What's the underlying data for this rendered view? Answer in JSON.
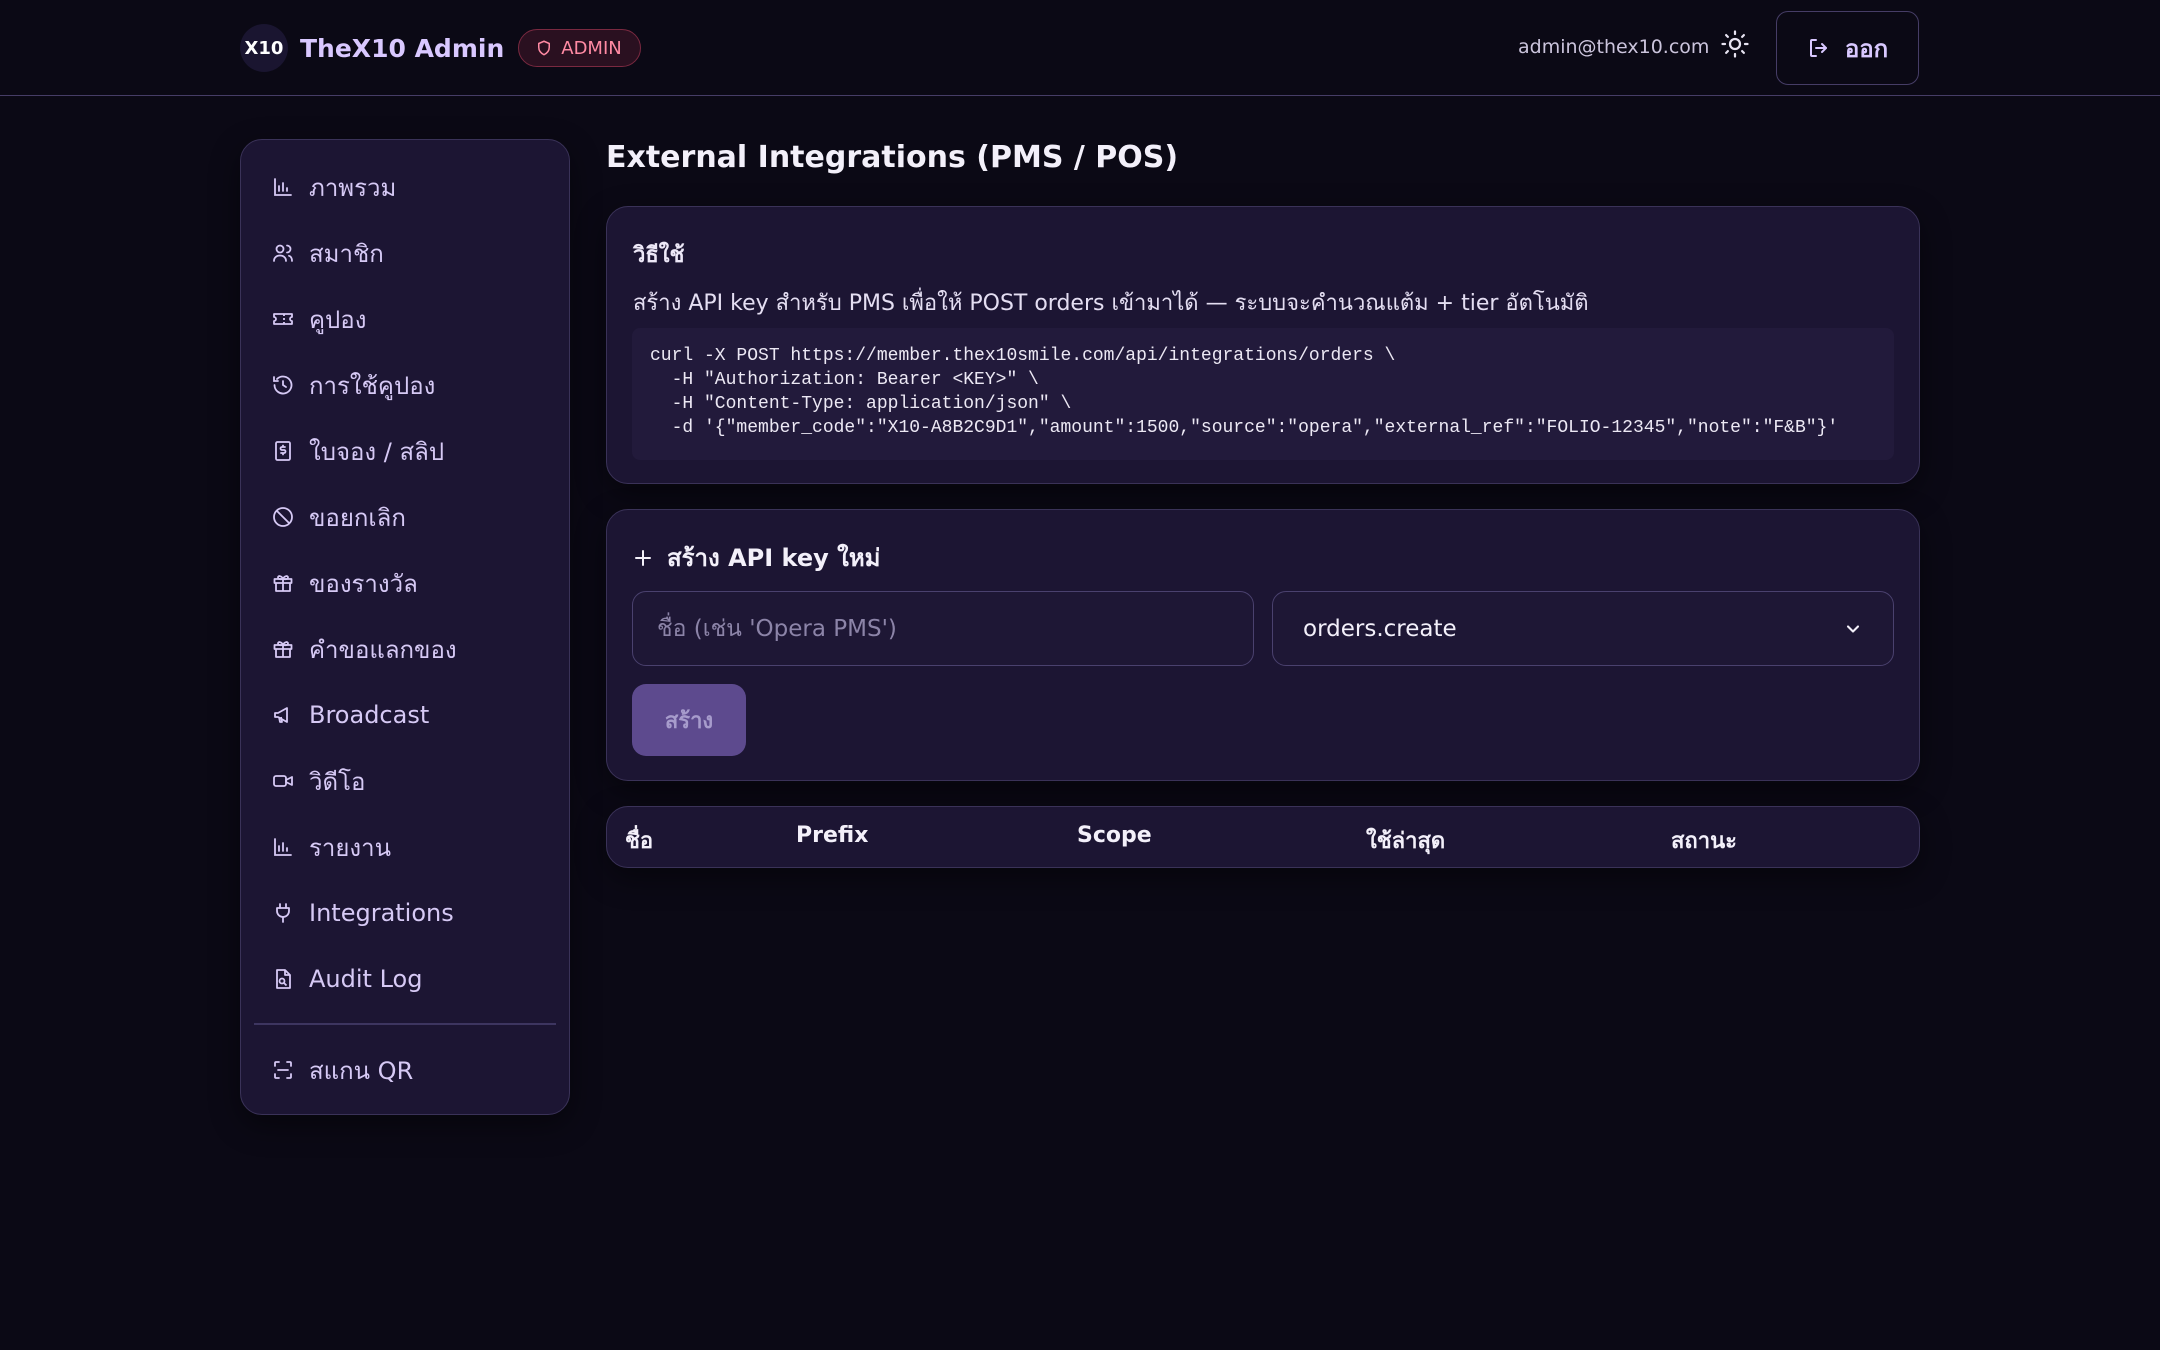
{
  "header": {
    "logo_text": "X10",
    "brand_name": "TheX10 Admin",
    "role_badge": "ADMIN",
    "user_email": "admin@thex10.com",
    "logout_label": "ออก"
  },
  "sidebar": {
    "items": [
      {
        "label": "ภาพรวม",
        "icon": "bar-chart-icon"
      },
      {
        "label": "สมาชิก",
        "icon": "users-icon"
      },
      {
        "label": "คูปอง",
        "icon": "ticket-icon"
      },
      {
        "label": "การใช้คูปอง",
        "icon": "history-icon"
      },
      {
        "label": "ใบจอง / สลิป",
        "icon": "receipt-icon"
      },
      {
        "label": "ขอยกเลิก",
        "icon": "ban-icon"
      },
      {
        "label": "ของรางวัล",
        "icon": "gift-icon"
      },
      {
        "label": "คำขอแลกของ",
        "icon": "gift-icon"
      },
      {
        "label": "Broadcast",
        "icon": "megaphone-icon"
      },
      {
        "label": "วิดีโอ",
        "icon": "video-icon"
      },
      {
        "label": "รายงาน",
        "icon": "bar-chart-icon"
      },
      {
        "label": "Integrations",
        "icon": "plug-icon"
      },
      {
        "label": "Audit Log",
        "icon": "file-search-icon"
      }
    ],
    "scan_label": "สแกน QR"
  },
  "main": {
    "title": "External Integrations (PMS / POS)",
    "howto": {
      "title": "วิธีใช้",
      "description": "สร้าง API key สำหรับ PMS เพื่อให้ POST orders เข้ามาได้ — ระบบจะคำนวณแต้ม + tier อัตโนมัติ",
      "code": "curl -X POST https://member.thex10smile.com/api/integrations/orders \\\n  -H \"Authorization: Bearer <KEY>\" \\\n  -H \"Content-Type: application/json\" \\\n  -d '{\"member_code\":\"X10-A8B2C9D1\",\"amount\":1500,\"source\":\"opera\",\"external_ref\":\"FOLIO-12345\",\"note\":\"F&B\"}'"
    },
    "create": {
      "title": "สร้าง API key ใหม่",
      "name_placeholder": "ชื่อ (เช่น 'Opera PMS')",
      "scope_value": "orders.create",
      "submit_label": "สร้าง"
    },
    "table": {
      "columns": [
        "ชื่อ",
        "Prefix",
        "Scope",
        "ใช้ล่าสุด",
        "สถานะ"
      ]
    }
  }
}
